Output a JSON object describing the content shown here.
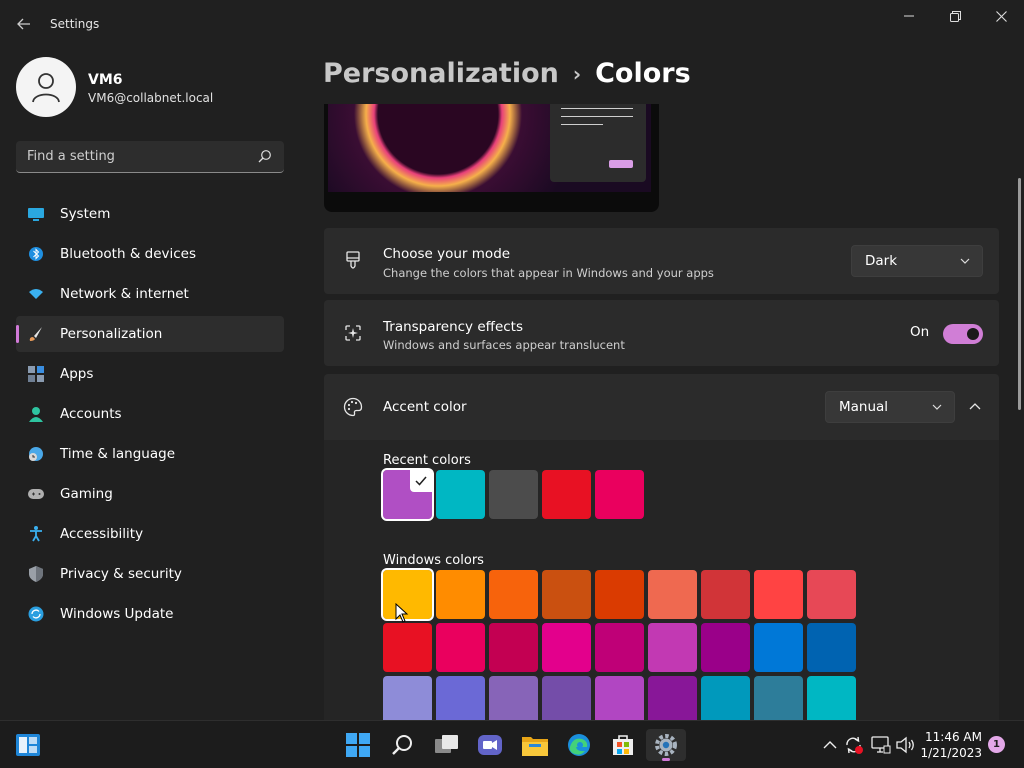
{
  "window": {
    "title": "Settings"
  },
  "profile": {
    "name": "VM6",
    "email": "VM6@collabnet.local"
  },
  "search": {
    "placeholder": "Find a setting"
  },
  "sidebar": {
    "items": [
      {
        "label": "System",
        "icon": "system-icon",
        "color": "#2aa8e0"
      },
      {
        "label": "Bluetooth & devices",
        "icon": "bluetooth-icon",
        "color": "#1f8fe0"
      },
      {
        "label": "Network & internet",
        "icon": "network-icon",
        "color": "#3ab1f0"
      },
      {
        "label": "Personalization",
        "icon": "brush-icon",
        "color": "#e89b5a",
        "active": true
      },
      {
        "label": "Apps",
        "icon": "apps-icon",
        "color": "#8a9bb0"
      },
      {
        "label": "Accounts",
        "icon": "accounts-icon",
        "color": "#2ec4a0"
      },
      {
        "label": "Time & language",
        "icon": "clock-globe-icon",
        "color": "#4aa8e8"
      },
      {
        "label": "Gaming",
        "icon": "gamepad-icon",
        "color": "#b0b0b0"
      },
      {
        "label": "Accessibility",
        "icon": "accessibility-icon",
        "color": "#3ab0f0"
      },
      {
        "label": "Privacy & security",
        "icon": "shield-icon",
        "color": "#9aa0a8"
      },
      {
        "label": "Windows Update",
        "icon": "update-icon",
        "color": "#2a9fe0"
      }
    ]
  },
  "breadcrumb": {
    "parent": "Personalization",
    "separator": "›",
    "current": "Colors"
  },
  "mode": {
    "title": "Choose your mode",
    "subtitle": "Change the colors that appear in Windows and your apps",
    "value": "Dark"
  },
  "transparency": {
    "title": "Transparency effects",
    "subtitle": "Windows and surfaces appear translucent",
    "state_label": "On"
  },
  "accent": {
    "title": "Accent color",
    "value": "Manual",
    "recent_label": "Recent colors",
    "recent_colors": [
      "#b04fc4",
      "#00b7c3",
      "#4c4c4c",
      "#e81123",
      "#ea005e"
    ],
    "windows_label": "Windows colors",
    "windows_colors": [
      [
        "#ffb900",
        "#ff8c00",
        "#f7630c",
        "#ca5010",
        "#da3b01",
        "#ef6950",
        "#d13438",
        "#ff4343",
        "#e74856"
      ],
      [
        "#e81123",
        "#ea005e",
        "#c30052",
        "#e3008c",
        "#bf0077",
        "#c239b3",
        "#9a0089",
        "#0078d7",
        "#0063b1"
      ],
      [
        "#8e8cd8",
        "#6b69d6",
        "#8764b8",
        "#744da9",
        "#b146c2",
        "#881798",
        "#0099bc",
        "#2d7d9a",
        "#00b7c3"
      ]
    ]
  },
  "accent_color": "#d17ad8",
  "taskbar": {
    "apps": [
      "windows-start-icon",
      "search-icon",
      "task-view-icon",
      "chat-icon",
      "file-explorer-icon",
      "edge-icon",
      "store-icon",
      "settings-icon"
    ],
    "time": "11:46 AM",
    "date": "1/21/2023",
    "notification_count": "1"
  }
}
